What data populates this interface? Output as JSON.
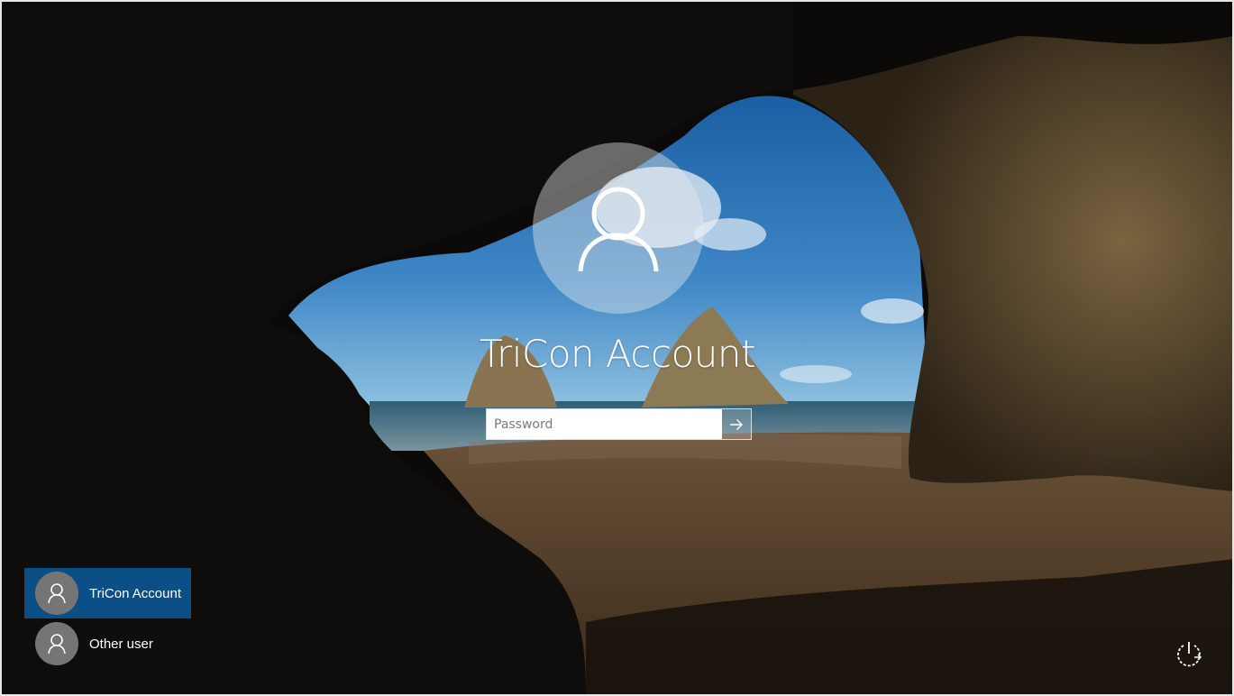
{
  "lock_screen": {
    "account_name": "TriCon Account",
    "password": {
      "placeholder": "Password",
      "value": ""
    },
    "submit_icon": "arrow-right-icon",
    "avatar_icon": "user-icon"
  },
  "users": [
    {
      "label": "TriCon Account",
      "selected": true,
      "icon": "user-icon"
    },
    {
      "label": "Other user",
      "selected": false,
      "icon": "user-icon"
    }
  ],
  "power": {
    "icon": "power-icon"
  },
  "colors": {
    "selected_user": "#0b4f86",
    "avatar_gray": "#757575"
  }
}
